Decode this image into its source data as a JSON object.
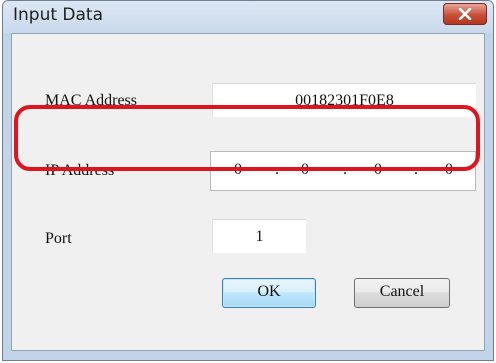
{
  "window": {
    "title": "Input Data",
    "close_icon": "close-icon"
  },
  "form": {
    "mac_label": "MAC Address",
    "mac_value": "00182301F0E8",
    "ip_label": "IP Address",
    "ip_octets": [
      "0",
      "0",
      "0",
      "0"
    ],
    "ip_separator": ".",
    "port_label": "Port",
    "port_value": "1"
  },
  "buttons": {
    "ok": "OK",
    "cancel": "Cancel"
  },
  "colors": {
    "highlight": "#e0141e",
    "close_button": "#c7503a",
    "ok_button_border": "#3c7fb1"
  }
}
